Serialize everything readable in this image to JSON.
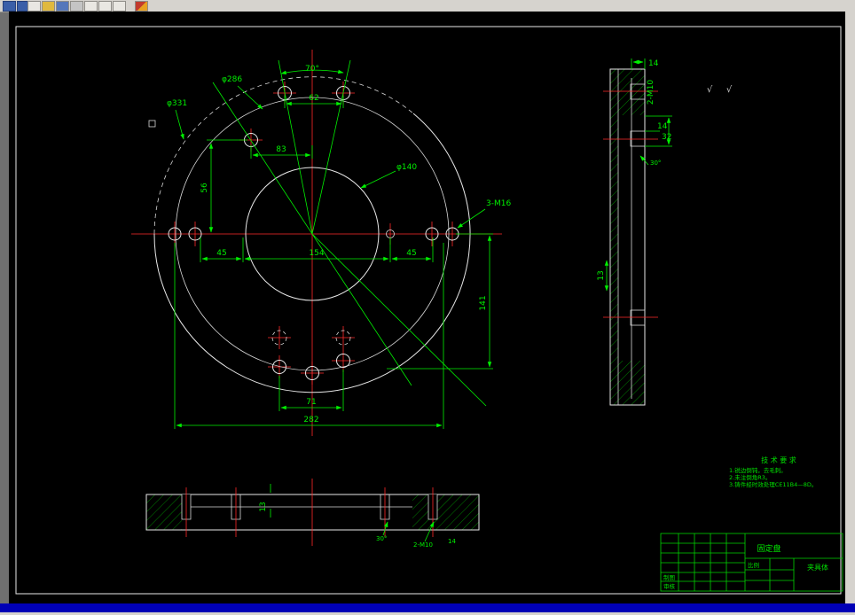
{
  "toolbar": {
    "icon_names": [
      "menu-fragment-icon",
      "window-icon",
      "new-file-icon",
      "open-file-icon",
      "save-file-icon",
      "print-icon",
      "print-preview-icon",
      "spell-check-icon",
      "cut-icon",
      "special-tool-icon"
    ]
  },
  "drawing": {
    "colors": {
      "geometry": "#e8e8e8",
      "dimension": "#00f000",
      "centerline": "#ff2a2a",
      "background": "#000000",
      "statusbar": "#0000b6"
    },
    "front_view": {
      "dia_outer": "φ331",
      "dia_bolt": "φ286",
      "dia_inner": "φ140",
      "angle_70": "70°",
      "dim_62": "62",
      "dim_83": "83",
      "dim_56": "56",
      "dim_45_left": "45",
      "dim_154": "154",
      "dim_45_right": "45",
      "dim_141": "141",
      "dim_71": "71",
      "dim_282": "282",
      "thread_3m16": "3-M16"
    },
    "side_view": {
      "dim_14_top": "14",
      "thread_2m10": "2-M10",
      "dim_14": "14",
      "dim_32": "32",
      "dim_13": "13",
      "angle_30": "30°"
    },
    "bottom_view": {
      "dim_13": "13",
      "angle_30": "30°",
      "thread_2m10": "2-M10",
      "dim_14": "14"
    },
    "roughness_symbol": "√",
    "tech_requirements": {
      "title": "技 术 要 求",
      "items": [
        "1.锐边倒钝，去毛刺。",
        "2.未注倒角R3。",
        "3.铸件经时效处理CE11B4—8D。"
      ]
    },
    "title_block": {
      "product_name": "固定盘",
      "part_name": "夹具体",
      "label_draw": "制图",
      "label_check": "审核",
      "label_scale": "比例"
    }
  }
}
